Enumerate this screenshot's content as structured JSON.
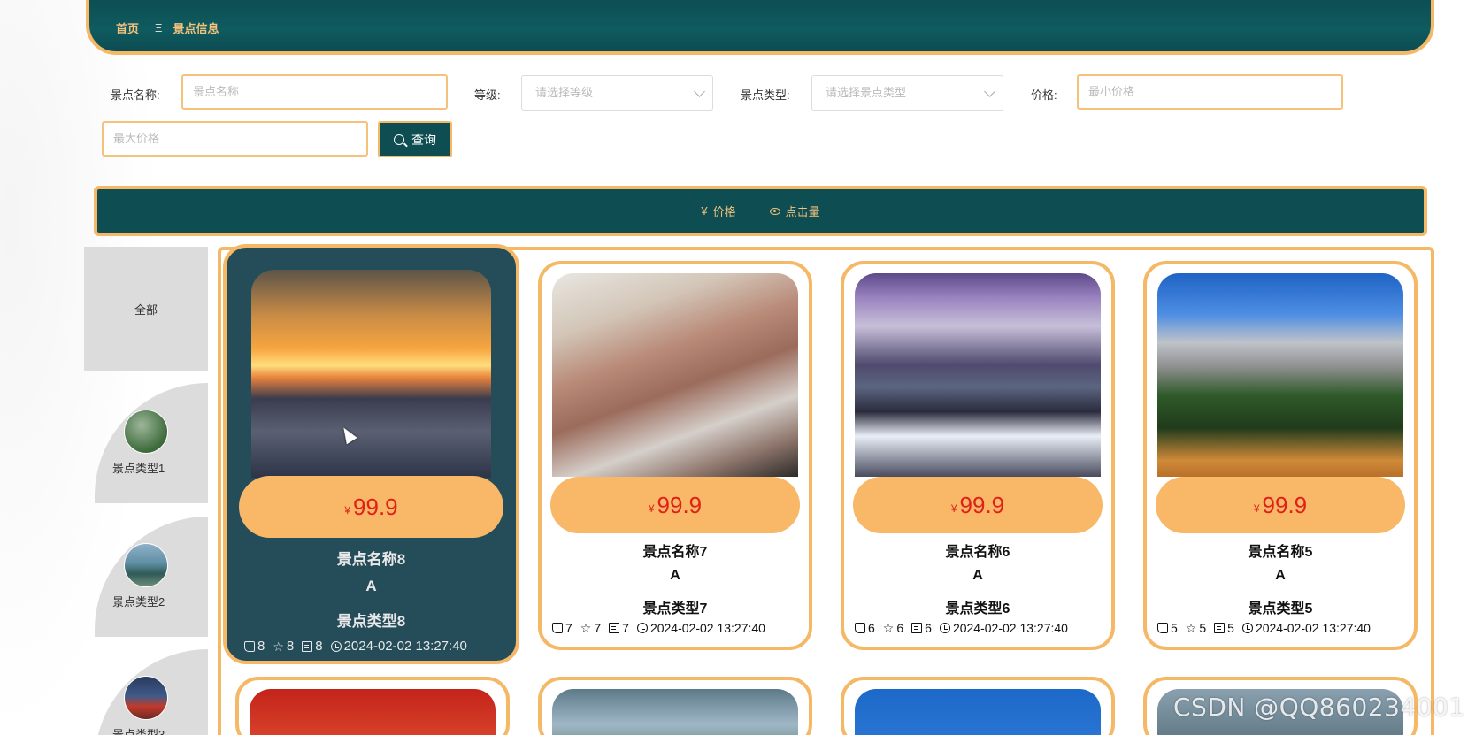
{
  "breadcrumb": {
    "home": "首页",
    "separator": "Ξ",
    "current": "景点信息"
  },
  "search": {
    "name_label": "景点名称:",
    "name_placeholder": "景点名称",
    "level_label": "等级:",
    "level_placeholder": "请选择等级",
    "type_label": "景点类型:",
    "type_placeholder": "请选择景点类型",
    "price_label": "价格:",
    "min_price_placeholder": "最小价格",
    "max_price_placeholder": "最大价格",
    "query_label": "查询"
  },
  "sort": {
    "price_label": "价格",
    "price_icon": "¥",
    "clicks_label": "点击量"
  },
  "categories": {
    "all": "全部",
    "items": [
      {
        "label": "景点类型1"
      },
      {
        "label": "景点类型2"
      },
      {
        "label": "景点类型3"
      }
    ]
  },
  "cards": [
    {
      "currency": "¥",
      "price": "99.9",
      "name": "景点名称8",
      "level": "A",
      "type": "景点类型8",
      "likes": "8",
      "favorites": "8",
      "comments": "8",
      "time": "2024-02-02 13:27:40"
    },
    {
      "currency": "¥",
      "price": "99.9",
      "name": "景点名称7",
      "level": "A",
      "type": "景点类型7",
      "likes": "7",
      "favorites": "7",
      "comments": "7",
      "time": "2024-02-02 13:27:40"
    },
    {
      "currency": "¥",
      "price": "99.9",
      "name": "景点名称6",
      "level": "A",
      "type": "景点类型6",
      "likes": "6",
      "favorites": "6",
      "comments": "6",
      "time": "2024-02-02 13:27:40"
    },
    {
      "currency": "¥",
      "price": "99.9",
      "name": "景点名称5",
      "level": "A",
      "type": "景点类型5",
      "likes": "5",
      "favorites": "5",
      "comments": "5",
      "time": "2024-02-02 13:27:40"
    }
  ],
  "watermark": "CSDN @QQ860234001",
  "colors": {
    "primary": "#0e4e52",
    "accent": "#f5b867",
    "price": "#e0201a",
    "active_card": "#254d59"
  }
}
